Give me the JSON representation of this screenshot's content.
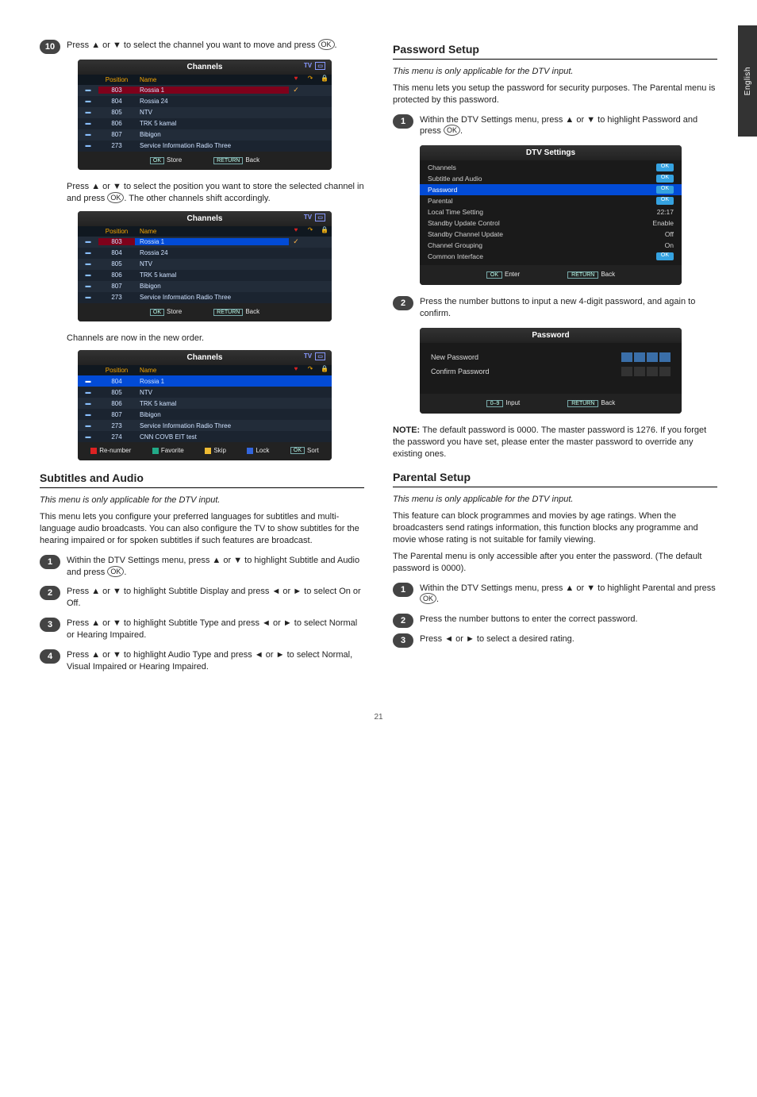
{
  "sidetab": "English",
  "footnote": "21",
  "left": {
    "step10": {
      "num": "10",
      "text_a": "Press ",
      "text_b": " or ",
      "text_c": " to select the channel you want to move and press ",
      "text_d": "."
    },
    "step10b": {
      "text_a": "Press ",
      "text_b": " or ",
      "text_c": " to select the position you want to store the selected channel in and press ",
      "text_d": ". The other channels shift accordingly."
    },
    "step10c": "Channels are now in the new order.",
    "osd_channels": {
      "title": "Channels",
      "tv": "TV",
      "head_position": "Position",
      "head_name": "Name",
      "rows": [
        {
          "pos": "803",
          "name": "Rossia 1"
        },
        {
          "pos": "804",
          "name": "Rossia 24"
        },
        {
          "pos": "805",
          "name": "NTV"
        },
        {
          "pos": "806",
          "name": "TRK 5 kamal"
        },
        {
          "pos": "807",
          "name": "Bibigon"
        },
        {
          "pos": "273",
          "name": "Service Information Radio Three"
        }
      ],
      "foot_store": "Store",
      "foot_back": "Back",
      "foot_ok": "OK",
      "foot_return": "RETURN"
    },
    "osd_channels3": {
      "rows": [
        {
          "pos": "804",
          "name": "Rossia 1"
        },
        {
          "pos": "805",
          "name": "NTV"
        },
        {
          "pos": "806",
          "name": "TRK 5 kamal"
        },
        {
          "pos": "807",
          "name": "Bibigon"
        },
        {
          "pos": "273",
          "name": "Service Information Radio Three"
        },
        {
          "pos": "274",
          "name": "CNN COVB EIT test"
        }
      ],
      "renumber": "Re-number",
      "favorite": "Favorite",
      "skip": "Skip",
      "lock": "Lock",
      "sort": "Sort",
      "ok": "OK"
    },
    "secA_title": "Subtitles and Audio",
    "secA_sub": "This menu is only applicable for the DTV input.",
    "secA_p1": "This menu lets you configure your preferred languages for subtitles and multi-language audio broadcasts. You can also configure the TV to show subtitles for the hearing impaired or for spoken subtitles if such features are broadcast.",
    "secA_steps": {
      "s1": {
        "num": "1",
        "a": "Within the DTV Settings menu, press ",
        "b": " or ",
        "c": " to highlight Subtitle and Audio and press ",
        "d": "."
      },
      "s2": {
        "num": "2",
        "a": "Press ",
        "b": " or ",
        "c": " to highlight Subtitle Display and press ",
        "d": " or ",
        "e": " to select On or Off."
      },
      "s3": {
        "num": "3",
        "a": "Press ",
        "b": " or ",
        "c": " to highlight Subtitle Type and press ",
        "d": " or ",
        "e": " to select Normal or Hearing Impaired."
      },
      "s4": {
        "num": "4",
        "a": "Press ",
        "b": " or ",
        "c": " to highlight Audio Type and press ",
        "d": " or ",
        "e": " to select Normal, Visual Impaired or Hearing Impaired."
      }
    }
  },
  "right": {
    "secB_title": "Password Setup",
    "secB_sub": "This menu is only applicable for the DTV input.",
    "secB_p1": "This menu lets you setup the password for security purposes. The Parental menu is protected by this password.",
    "secB_s1": {
      "num": "1",
      "a": "Within the DTV Settings menu, press ",
      "b": " or ",
      "c": " to highlight Password and press ",
      "d": "."
    },
    "dtv": {
      "title": "DTV Settings",
      "rows": [
        {
          "label": "Channels",
          "val": "OK",
          "btn": true
        },
        {
          "label": "Subtitle and Audio",
          "val": "OK",
          "btn": true
        },
        {
          "label": "Password",
          "val": "OK",
          "btn": true,
          "hl": true
        },
        {
          "label": "Parental",
          "val": "OK",
          "btn": true
        },
        {
          "label": "Local Time Setting",
          "val": "22:17"
        },
        {
          "label": "Standby Update Control",
          "val": "Enable"
        },
        {
          "label": "Standby Channel Update",
          "val": "Off"
        },
        {
          "label": "Channel Grouping",
          "val": "On"
        },
        {
          "label": "Common Interface",
          "val": "OK",
          "btn": true
        }
      ],
      "foot_enter": "Enter",
      "foot_back": "Back",
      "foot_ok": "OK",
      "foot_return": "RETURN"
    },
    "secB_s2": {
      "num": "2",
      "text": "Press the number buttons to input a new 4-digit password, and again to confirm."
    },
    "pw_panel": {
      "title": "Password",
      "new": "New Password",
      "confirm": "Confirm Password",
      "foot_input": "Input",
      "foot_back": "Back",
      "foot_09": "0–9",
      "foot_return": "RETURN"
    },
    "secB_note": {
      "label": "NOTE:",
      "text": " The default password is 0000. The master password is 1276. If you forget the password you have set, please enter the master password to override any existing ones."
    },
    "secC_title": "Parental Setup",
    "secC_sub": "This menu is only applicable for the DTV input.",
    "secC_p1": "This feature can block programmes and movies by age ratings. When the broadcasters send ratings information, this function blocks any programme and movie whose rating is not suitable for family viewing.",
    "secC_p2": "The Parental menu is only accessible after you enter the password. (The default password is 0000).",
    "secC_s1": {
      "num": "1",
      "a": "Within the DTV Settings menu, press ",
      "b": " or ",
      "c": " to highlight Parental and press ",
      "d": "."
    },
    "secC_s2": {
      "num": "2",
      "text": "Press the number buttons to enter the correct password."
    },
    "secC_s3": {
      "num": "3",
      "a": "Press ",
      "b": " or ",
      "c": " to select a desired rating."
    }
  }
}
